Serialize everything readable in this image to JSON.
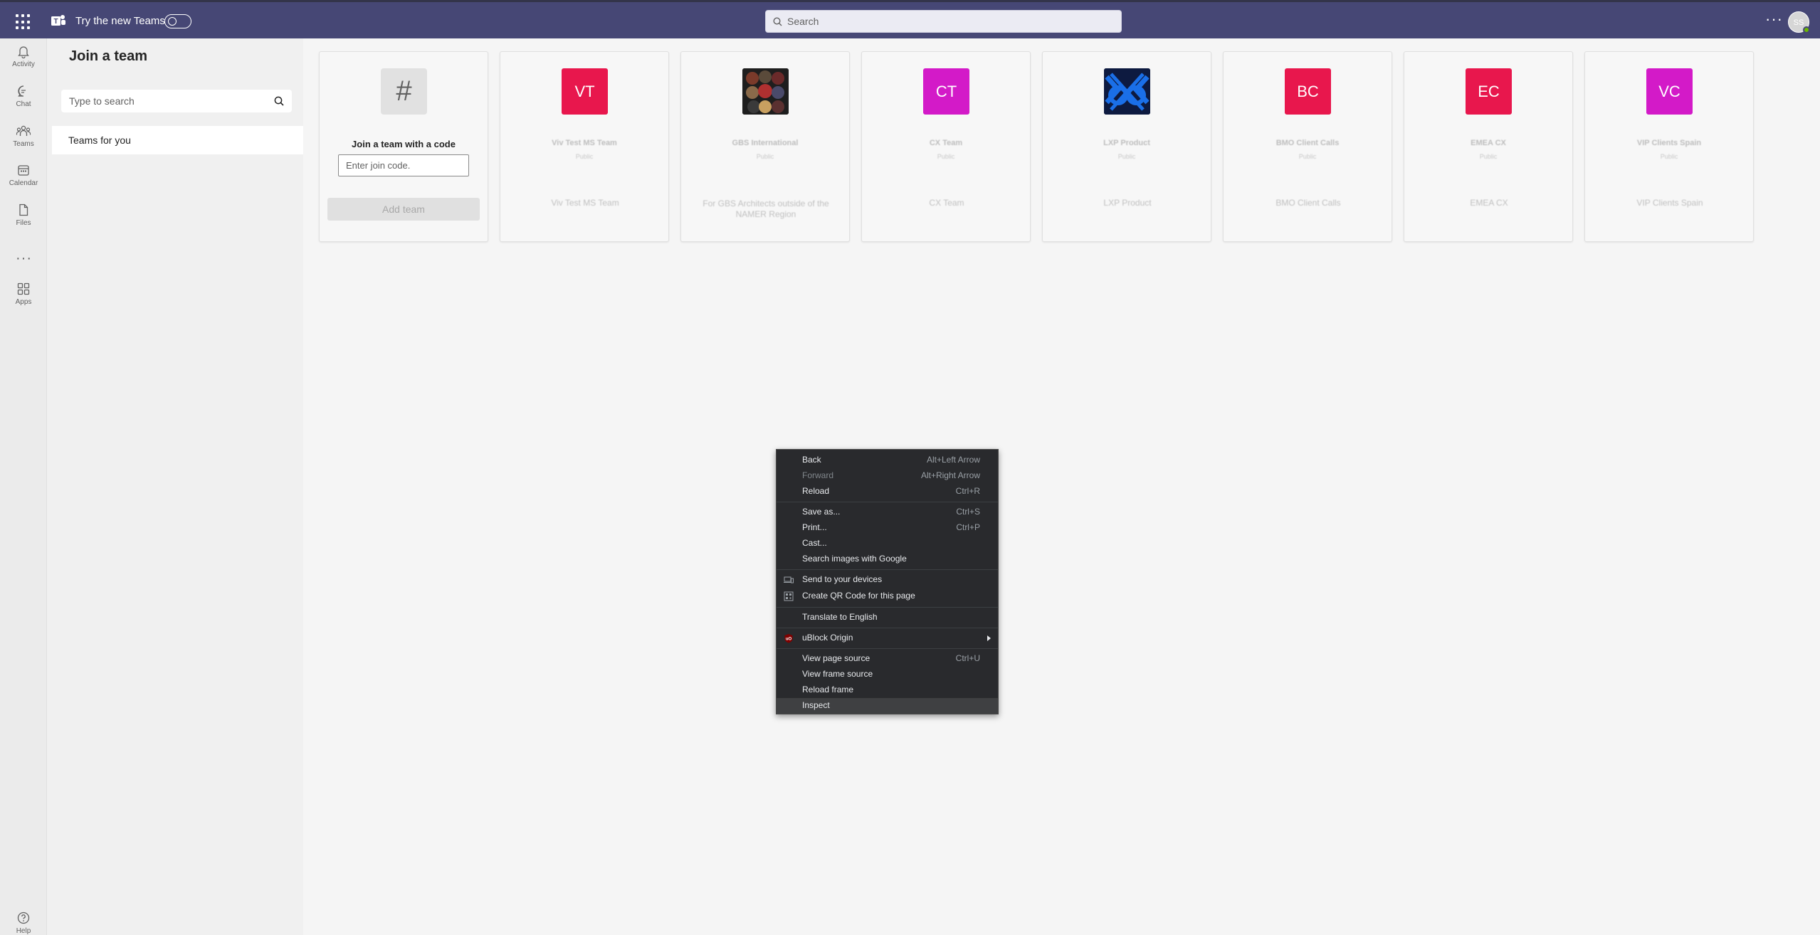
{
  "topbar": {
    "try_label": "Try the new Teams",
    "search_placeholder": "Search",
    "avatar_initials": "SS"
  },
  "rail": {
    "items": [
      {
        "label": "Activity"
      },
      {
        "label": "Chat"
      },
      {
        "label": "Teams"
      },
      {
        "label": "Calendar"
      },
      {
        "label": "Files"
      },
      {
        "label": "Apps"
      },
      {
        "label": "Help"
      }
    ],
    "more": "···"
  },
  "panel": {
    "title": "Join a team",
    "search_placeholder": "Type to search",
    "teams_for_you": "Teams for you"
  },
  "join_code_card": {
    "hash": "#",
    "title": "Join a team with a code",
    "input_placeholder": "Enter join code.",
    "add_button": "Add team"
  },
  "team_cards": [
    {
      "initials": "VT",
      "name": "Viv Test MS Team",
      "visibility": "Public",
      "description": "Viv Test MS Team",
      "color": "#e8174d",
      "image": false
    },
    {
      "initials": "",
      "name": "GBS International",
      "visibility": "Public",
      "description": "For GBS Architects outside of the NAMER Region",
      "color": "#2b2b2b",
      "image": true
    },
    {
      "initials": "CT",
      "name": "CX Team",
      "visibility": "Public",
      "description": "CX Team",
      "color": "#d31ac8",
      "image": false
    },
    {
      "initials": "",
      "name": "LXP Product",
      "visibility": "Public",
      "description": "LXP Product",
      "color": "#1a5fd6",
      "image": true
    },
    {
      "initials": "BC",
      "name": "BMO Client Calls",
      "visibility": "Public",
      "description": "BMO Client Calls",
      "color": "#e8174d",
      "image": false
    },
    {
      "initials": "EC",
      "name": "EMEA CX",
      "visibility": "Public",
      "description": "EMEA CX",
      "color": "#e8174d",
      "image": false
    },
    {
      "initials": "VC",
      "name": "VIP Clients Spain",
      "visibility": "Public",
      "description": "VIP Clients Spain",
      "color": "#d31ac8",
      "image": false
    }
  ],
  "context_menu": {
    "back": {
      "label": "Back",
      "shortcut": "Alt+Left Arrow"
    },
    "forward": {
      "label": "Forward",
      "shortcut": "Alt+Right Arrow"
    },
    "reload": {
      "label": "Reload",
      "shortcut": "Ctrl+R"
    },
    "save_as": {
      "label": "Save as...",
      "shortcut": "Ctrl+S"
    },
    "print": {
      "label": "Print...",
      "shortcut": "Ctrl+P"
    },
    "cast": {
      "label": "Cast..."
    },
    "search_images": {
      "label": "Search images with Google"
    },
    "send_devices": {
      "label": "Send to your devices"
    },
    "qr_code": {
      "label": "Create QR Code for this page"
    },
    "translate": {
      "label": "Translate to English"
    },
    "ublock": {
      "label": "uBlock Origin"
    },
    "view_source": {
      "label": "View page source",
      "shortcut": "Ctrl+U"
    },
    "view_frame_source": {
      "label": "View frame source"
    },
    "reload_frame": {
      "label": "Reload frame"
    },
    "inspect": {
      "label": "Inspect"
    }
  }
}
